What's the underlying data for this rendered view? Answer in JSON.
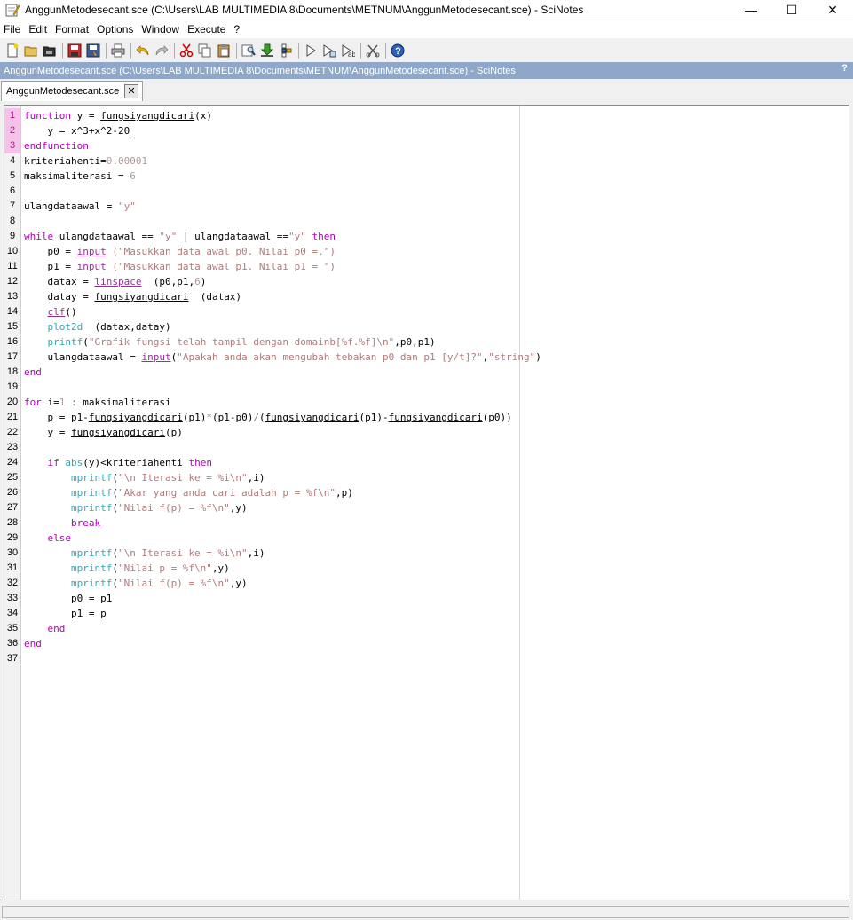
{
  "window": {
    "title": "AnggunMetodesecant.sce (C:\\Users\\LAB MULTIMEDIA 8\\Documents\\METNUM\\AnggunMetodesecant.sce) - SciNotes",
    "controls": {
      "minimize": "—",
      "maximize": "☐",
      "close": "✕"
    }
  },
  "menu": [
    "File",
    "Edit",
    "Format",
    "Options",
    "Window",
    "Execute",
    "?"
  ],
  "toolbar": {
    "icons": [
      "new-file-icon",
      "open-file-icon",
      "open-recent-icon",
      "save-icon",
      "save-as-icon",
      "print-icon",
      "undo-icon",
      "redo-icon",
      "cut-icon",
      "copy-icon",
      "paste-icon",
      "find-replace-icon",
      "load-into-scilab-icon",
      "execute-file-icon",
      "execute-icon",
      "execute-echo-icon",
      "execute-selection-icon",
      "clear-icon",
      "help-icon"
    ]
  },
  "pathbar": {
    "path": "AnggunMetodesecant.sce (C:\\Users\\LAB MULTIMEDIA 8\\Documents\\METNUM\\AnggunMetodesecant.sce) - SciNotes",
    "help": "?"
  },
  "tab": {
    "label": "AnggunMetodesecant.sce",
    "close": "✕"
  },
  "editor": {
    "selected_lines": [
      1,
      2,
      3
    ],
    "lines": [
      {
        "n": "1",
        "t": [
          [
            "kw",
            "function "
          ],
          [
            "",
            "y = "
          ],
          [
            "ufn",
            "fungsiyangdicari"
          ],
          [
            "",
            "(x)"
          ]
        ]
      },
      {
        "n": "2",
        "t": [
          [
            "",
            "    y = x^3+x^2-20"
          ]
        ],
        "cursor": true
      },
      {
        "n": "3",
        "t": [
          [
            "kw",
            "endfunction"
          ]
        ]
      },
      {
        "n": "4",
        "t": [
          [
            "",
            "kriteriahenti="
          ],
          [
            "num",
            "0.00001"
          ]
        ]
      },
      {
        "n": "5",
        "t": [
          [
            "",
            "maksimaliterasi = "
          ],
          [
            "num",
            "6"
          ]
        ]
      },
      {
        "n": "6",
        "t": []
      },
      {
        "n": "7",
        "t": [
          [
            "",
            "ulangdataawal = "
          ],
          [
            "str",
            "\"y\""
          ]
        ]
      },
      {
        "n": "8",
        "t": []
      },
      {
        "n": "9",
        "t": [
          [
            "kw",
            "while "
          ],
          [
            "",
            "ulangdataawal == "
          ],
          [
            "str",
            "\"y\""
          ],
          [
            "op",
            " | "
          ],
          [
            "",
            "ulangdataawal =="
          ],
          [
            "str",
            "\"y\""
          ],
          [
            "kw",
            " then"
          ]
        ]
      },
      {
        "n": "10",
        "t": [
          [
            "",
            "    p0 = "
          ],
          [
            "fn",
            "input"
          ],
          [
            "str",
            " (\"Masukkan data awal p0. Nilai p0 =.\")"
          ]
        ]
      },
      {
        "n": "11",
        "t": [
          [
            "",
            "    p1 = "
          ],
          [
            "fn",
            "input"
          ],
          [
            "str",
            " (\"Masukkan data awal p1. Nilai p1 = \")"
          ]
        ]
      },
      {
        "n": "12",
        "t": [
          [
            "",
            "    datax = "
          ],
          [
            "fn",
            "linspace"
          ],
          [
            "",
            ""
          ],
          [
            "",
            "  (p0,p1,"
          ],
          [
            "num",
            "6"
          ],
          [
            "",
            ")"
          ]
        ]
      },
      {
        "n": "13",
        "t": [
          [
            "",
            "    datay = "
          ],
          [
            "ufn",
            "fungsiyangdicari"
          ],
          [
            "",
            "  (datax)"
          ]
        ]
      },
      {
        "n": "14",
        "t": [
          [
            "",
            "    "
          ],
          [
            "fn",
            "clf"
          ],
          [
            "",
            "()"
          ]
        ]
      },
      {
        "n": "15",
        "t": [
          [
            "",
            "    "
          ],
          [
            "blt",
            "plot2d"
          ],
          [
            "",
            "  (datax,datay)"
          ]
        ]
      },
      {
        "n": "16",
        "t": [
          [
            "",
            "    "
          ],
          [
            "blt",
            "printf"
          ],
          [
            "",
            "("
          ],
          [
            "str",
            "\"Grafik fungsi telah tampil dengan domainb[%f.%f]\\n\""
          ],
          [
            "",
            ",p0,p1)"
          ]
        ]
      },
      {
        "n": "17",
        "t": [
          [
            "",
            "    ulangdataawal = "
          ],
          [
            "fn",
            "input"
          ],
          [
            "",
            "("
          ],
          [
            "str",
            "\"Apakah anda akan mengubah tebakan p0 dan p1 [y/t]?\""
          ],
          [
            "",
            ","
          ],
          [
            "str",
            "\"string\""
          ],
          [
            "",
            ")"
          ]
        ]
      },
      {
        "n": "18",
        "t": [
          [
            "kw",
            "end"
          ]
        ]
      },
      {
        "n": "19",
        "t": []
      },
      {
        "n": "20",
        "t": [
          [
            "kw",
            "for "
          ],
          [
            "",
            "i="
          ],
          [
            "num",
            "1"
          ],
          [
            "op",
            " : "
          ],
          [
            "",
            "maksimaliterasi"
          ]
        ]
      },
      {
        "n": "21",
        "t": [
          [
            "",
            "    p = p1-"
          ],
          [
            "ufn",
            "fungsiyangdicari"
          ],
          [
            "",
            "(p1)"
          ],
          [
            "op",
            "*"
          ],
          [
            "",
            "(p1-p0)"
          ],
          [
            "op",
            "/"
          ],
          [
            "",
            "("
          ],
          [
            "ufn",
            "fungsiyangdicari"
          ],
          [
            "",
            "(p1)-"
          ],
          [
            "ufn",
            "fungsiyangdicari"
          ],
          [
            "",
            "(p0))"
          ]
        ]
      },
      {
        "n": "22",
        "t": [
          [
            "",
            "    y = "
          ],
          [
            "ufn",
            "fungsiyangdicari"
          ],
          [
            "",
            "(p)"
          ]
        ]
      },
      {
        "n": "23",
        "t": [
          [
            "",
            "    "
          ]
        ]
      },
      {
        "n": "24",
        "t": [
          [
            "",
            "    "
          ],
          [
            "kw",
            "if "
          ],
          [
            "blt",
            "abs"
          ],
          [
            "",
            "(y)<kriteriahenti "
          ],
          [
            "kw",
            "then"
          ]
        ]
      },
      {
        "n": "25",
        "t": [
          [
            "",
            "        "
          ],
          [
            "blt",
            "mprintf"
          ],
          [
            "",
            "("
          ],
          [
            "str",
            "\"\\n Iterasi ke = %i\\n\""
          ],
          [
            "",
            ",i)"
          ]
        ]
      },
      {
        "n": "26",
        "t": [
          [
            "",
            "        "
          ],
          [
            "blt",
            "mprintf"
          ],
          [
            "",
            "("
          ],
          [
            "str",
            "\"Akar yang anda cari adalah p = %f\\n\""
          ],
          [
            "",
            ",p)"
          ]
        ]
      },
      {
        "n": "27",
        "t": [
          [
            "",
            "        "
          ],
          [
            "blt",
            "mprintf"
          ],
          [
            "",
            "("
          ],
          [
            "str",
            "\"Nilai f(p) = %f\\n\""
          ],
          [
            "",
            ",y)"
          ]
        ]
      },
      {
        "n": "28",
        "t": [
          [
            "",
            "        "
          ],
          [
            "kw",
            "break"
          ]
        ]
      },
      {
        "n": "29",
        "t": [
          [
            "",
            "    "
          ],
          [
            "kw",
            "else"
          ]
        ]
      },
      {
        "n": "30",
        "t": [
          [
            "",
            "        "
          ],
          [
            "blt",
            "mprintf"
          ],
          [
            "",
            "("
          ],
          [
            "str",
            "\"\\n Iterasi ke = %i\\n\""
          ],
          [
            "",
            ",i)"
          ]
        ]
      },
      {
        "n": "31",
        "t": [
          [
            "",
            "        "
          ],
          [
            "blt",
            "mprintf"
          ],
          [
            "",
            "("
          ],
          [
            "str",
            "\"Nilai p = %f\\n\""
          ],
          [
            "",
            ",y)"
          ]
        ]
      },
      {
        "n": "32",
        "t": [
          [
            "",
            "        "
          ],
          [
            "blt",
            "mprintf"
          ],
          [
            "",
            "("
          ],
          [
            "str",
            "\"Nilai f(p) = %f\\n\""
          ],
          [
            "",
            ",y)"
          ]
        ]
      },
      {
        "n": "33",
        "t": [
          [
            "",
            "        p0 = p1"
          ]
        ]
      },
      {
        "n": "34",
        "t": [
          [
            "",
            "        p1 = p"
          ]
        ]
      },
      {
        "n": "35",
        "t": [
          [
            "",
            "    "
          ],
          [
            "kw",
            "end"
          ]
        ]
      },
      {
        "n": "36",
        "t": [
          [
            "kw",
            "end"
          ]
        ]
      },
      {
        "n": "37",
        "t": []
      }
    ]
  },
  "colors": {
    "pathbar": "#8fa8c9",
    "keyword": "#b000b8",
    "selected_gutter": "#f5c3ea"
  }
}
